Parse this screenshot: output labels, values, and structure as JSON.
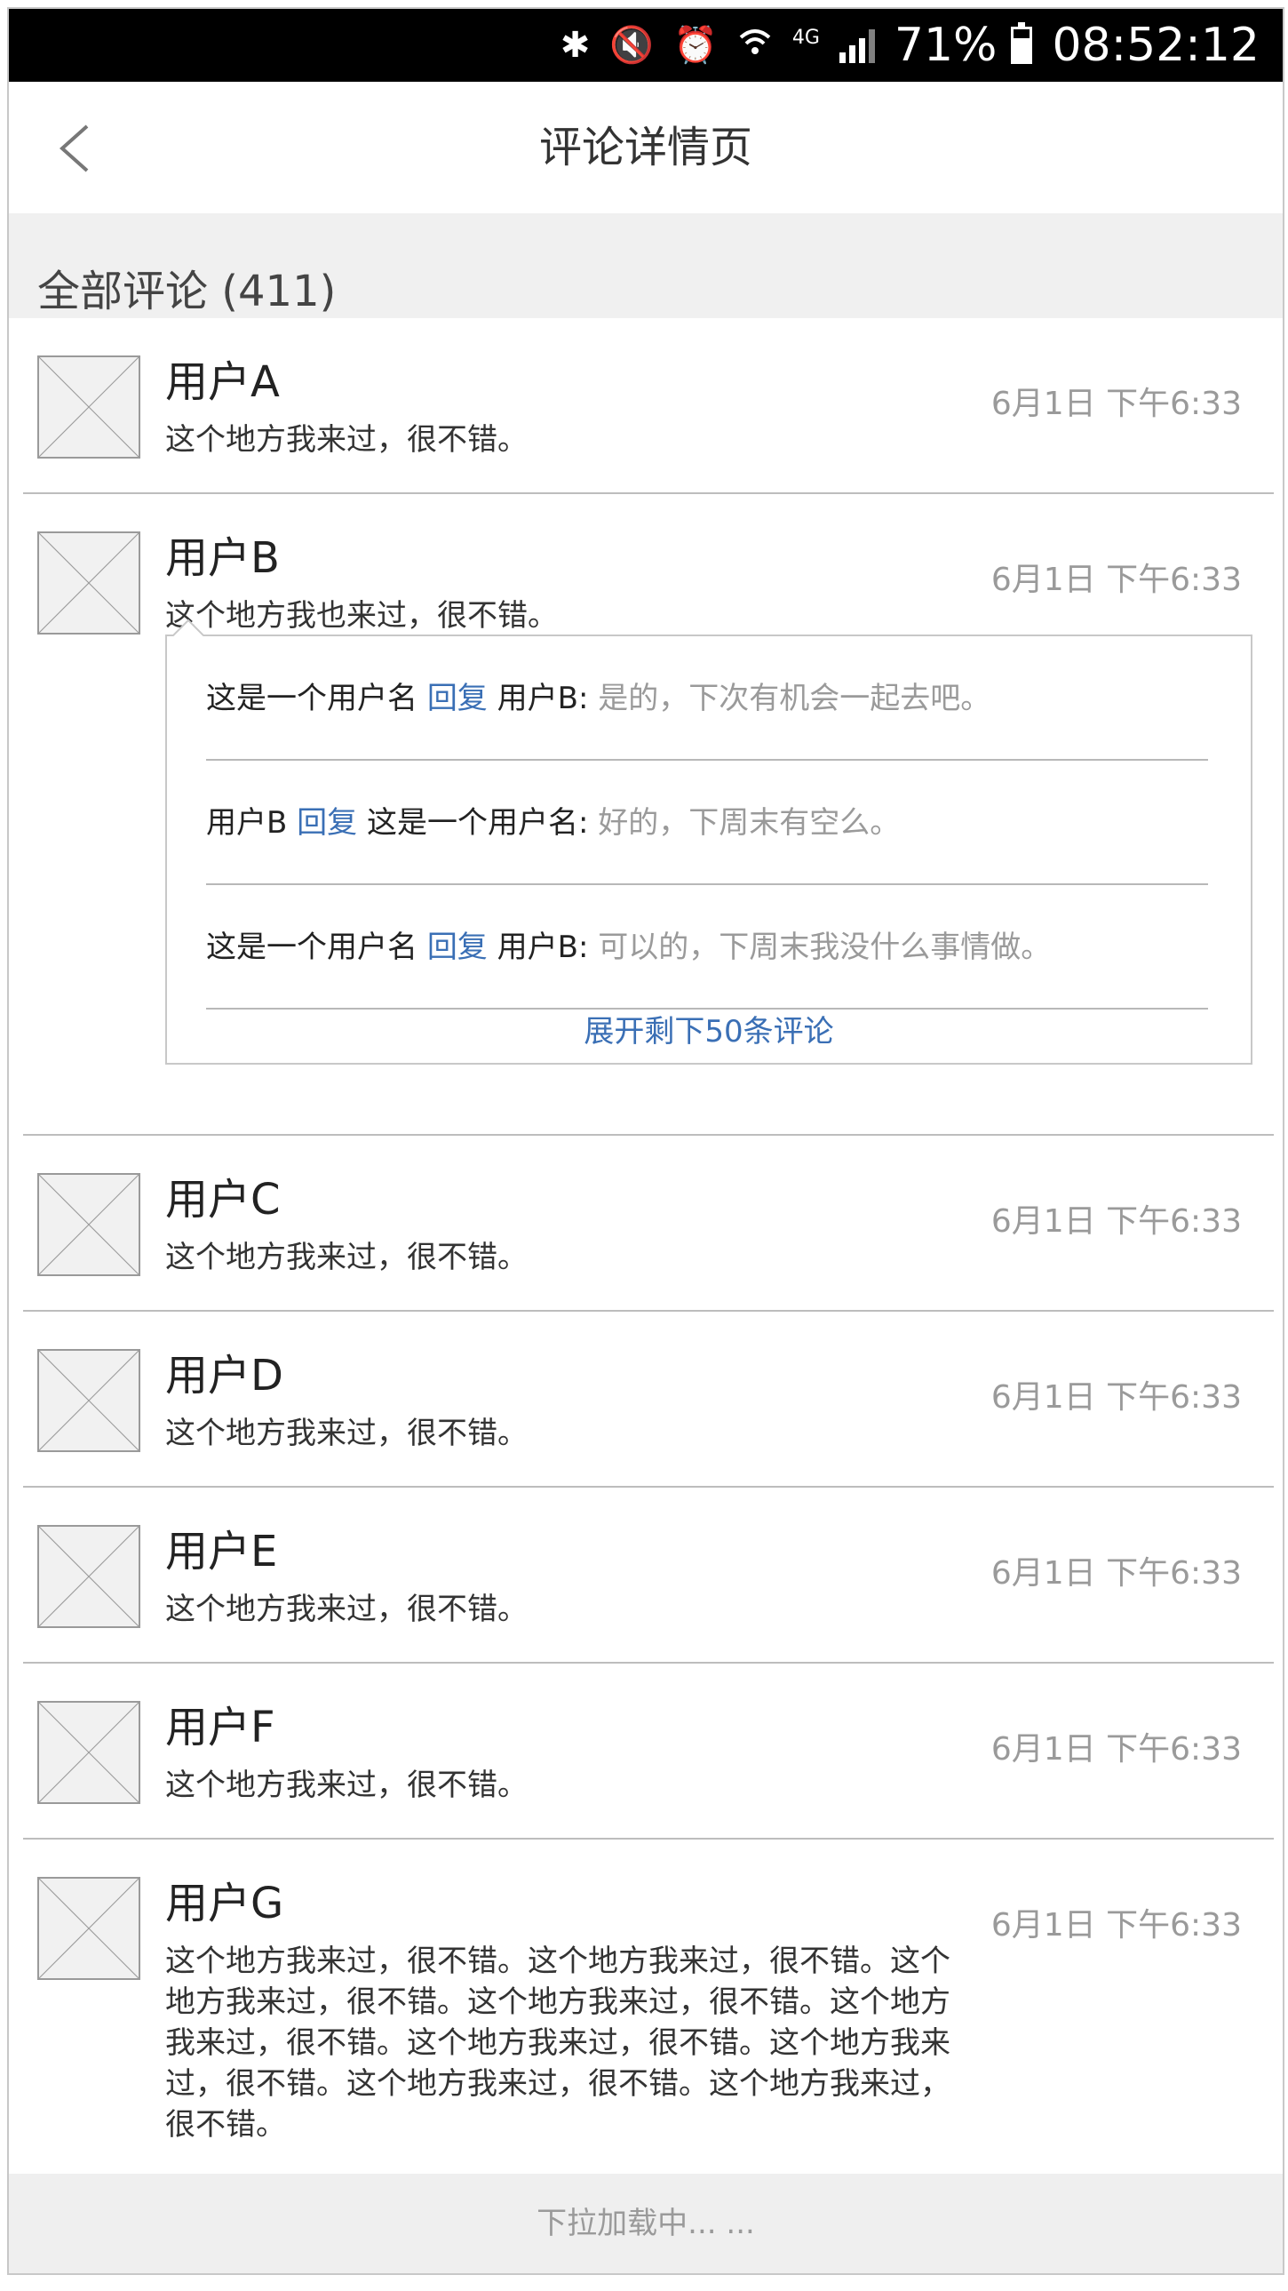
{
  "status_bar": {
    "battery": "71%",
    "time": "08:52:12",
    "network": "4G",
    "icons": [
      "bluetooth-icon",
      "mute-icon",
      "alarm-icon",
      "wifi-icon",
      "signal-icon",
      "battery-icon"
    ]
  },
  "nav": {
    "title": "评论详情页",
    "back_icon": "chevron-left-icon"
  },
  "section": {
    "title": "全部评论 (411)"
  },
  "comments": [
    {
      "user": "用户A",
      "text": "这个地方我来过，很不错。",
      "time": "6月1日 下午6:33"
    },
    {
      "user": "用户B",
      "text": "这个地方我也来过，很不错。",
      "time": "6月1日 下午6:33"
    },
    {
      "user": "用户C",
      "text": "这个地方我来过，很不错。",
      "time": "6月1日 下午6:33"
    },
    {
      "user": "用户D",
      "text": "这个地方我来过，很不错。",
      "time": "6月1日 下午6:33"
    },
    {
      "user": "用户E",
      "text": "这个地方我来过，很不错。",
      "time": "6月1日 下午6:33"
    },
    {
      "user": "用户F",
      "text": "这个地方我来过，很不错。",
      "time": "6月1日 下午6:33"
    },
    {
      "user": "用户G",
      "text": "这个地方我来过，很不错。这个地方我来过，很不错。这个地方我来过，很不错。这个地方我来过，很不错。这个地方我来过，很不错。这个地方我来过，很不错。这个地方我来过，很不错。这个地方我来过，很不错。这个地方我来过，很不错。",
      "time": "6月1日 下午6:33"
    }
  ],
  "replies": [
    {
      "from": "这是一个用户名",
      "action": "回复",
      "to": "用户B:",
      "message": "是的，下次有机会一起去吧。"
    },
    {
      "from": "用户B",
      "action": "回复",
      "to": "这是一个用户名:",
      "message": "好的，下周末有空么。"
    },
    {
      "from": "这是一个用户名",
      "action": "回复",
      "to": "用户B:",
      "message": "可以的，下周末我没什么事情做。"
    }
  ],
  "expand_label": "展开剩下50条评论",
  "footer": {
    "loading": "下拉加载中... ..."
  },
  "colors": {
    "link": "#3a6fb5",
    "muted": "#9a9a9a",
    "status_bar": "#000000"
  }
}
